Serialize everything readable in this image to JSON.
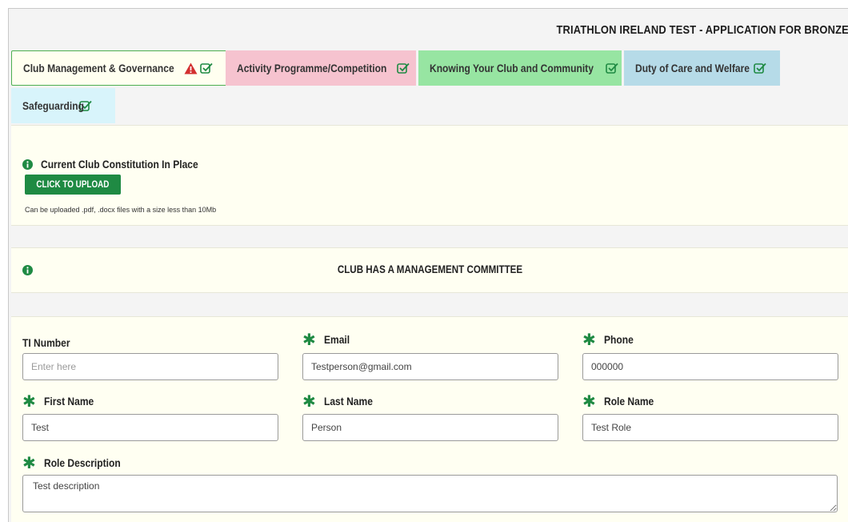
{
  "app_title": "TRIATHLON IRELAND TEST - APPLICATION FOR BRONZE",
  "tabs": [
    {
      "label": "Club Management & Governance",
      "status": "warning-complete"
    },
    {
      "label": "Activity Programme/Competition",
      "status": "complete"
    },
    {
      "label": "Knowing Your Club and Community",
      "status": "complete"
    },
    {
      "label": "Duty of Care and Welfare",
      "status": "complete"
    },
    {
      "label": "Safeguarding",
      "status": "complete"
    }
  ],
  "constitution": {
    "title": "Current Club Constitution In Place",
    "upload_label": "CLICK TO UPLOAD",
    "hint": "Can be uploaded .pdf, .docx files with a size less than 10Mb"
  },
  "committee": {
    "title": "CLUB HAS A MANAGEMENT COMMITTEE"
  },
  "form": {
    "ti_number": {
      "label": "TI Number",
      "value": "",
      "placeholder": "Enter here"
    },
    "email": {
      "label": "Email",
      "value": "Testperson@gmail.com"
    },
    "phone": {
      "label": "Phone",
      "value": "000000"
    },
    "first_name": {
      "label": "First Name",
      "value": "Test"
    },
    "last_name": {
      "label": "Last Name",
      "value": "Person"
    },
    "role_name": {
      "label": "Role Name",
      "value": "Test Role"
    },
    "role_description": {
      "label": "Role Description",
      "value": "Test description"
    }
  },
  "colors": {
    "accent_green": "#1f8a43",
    "warning_red": "#d32f2f",
    "tab_activity": "#f6c3cf",
    "tab_knowing": "#97e5a2",
    "tab_duty": "#b6dbe8",
    "tab_safeguarding": "#d8f4fb"
  },
  "icons": {
    "warning": "warning-triangle-icon",
    "check": "check-square-icon",
    "info": "info-circle-icon",
    "required": "asterisk-icon"
  }
}
